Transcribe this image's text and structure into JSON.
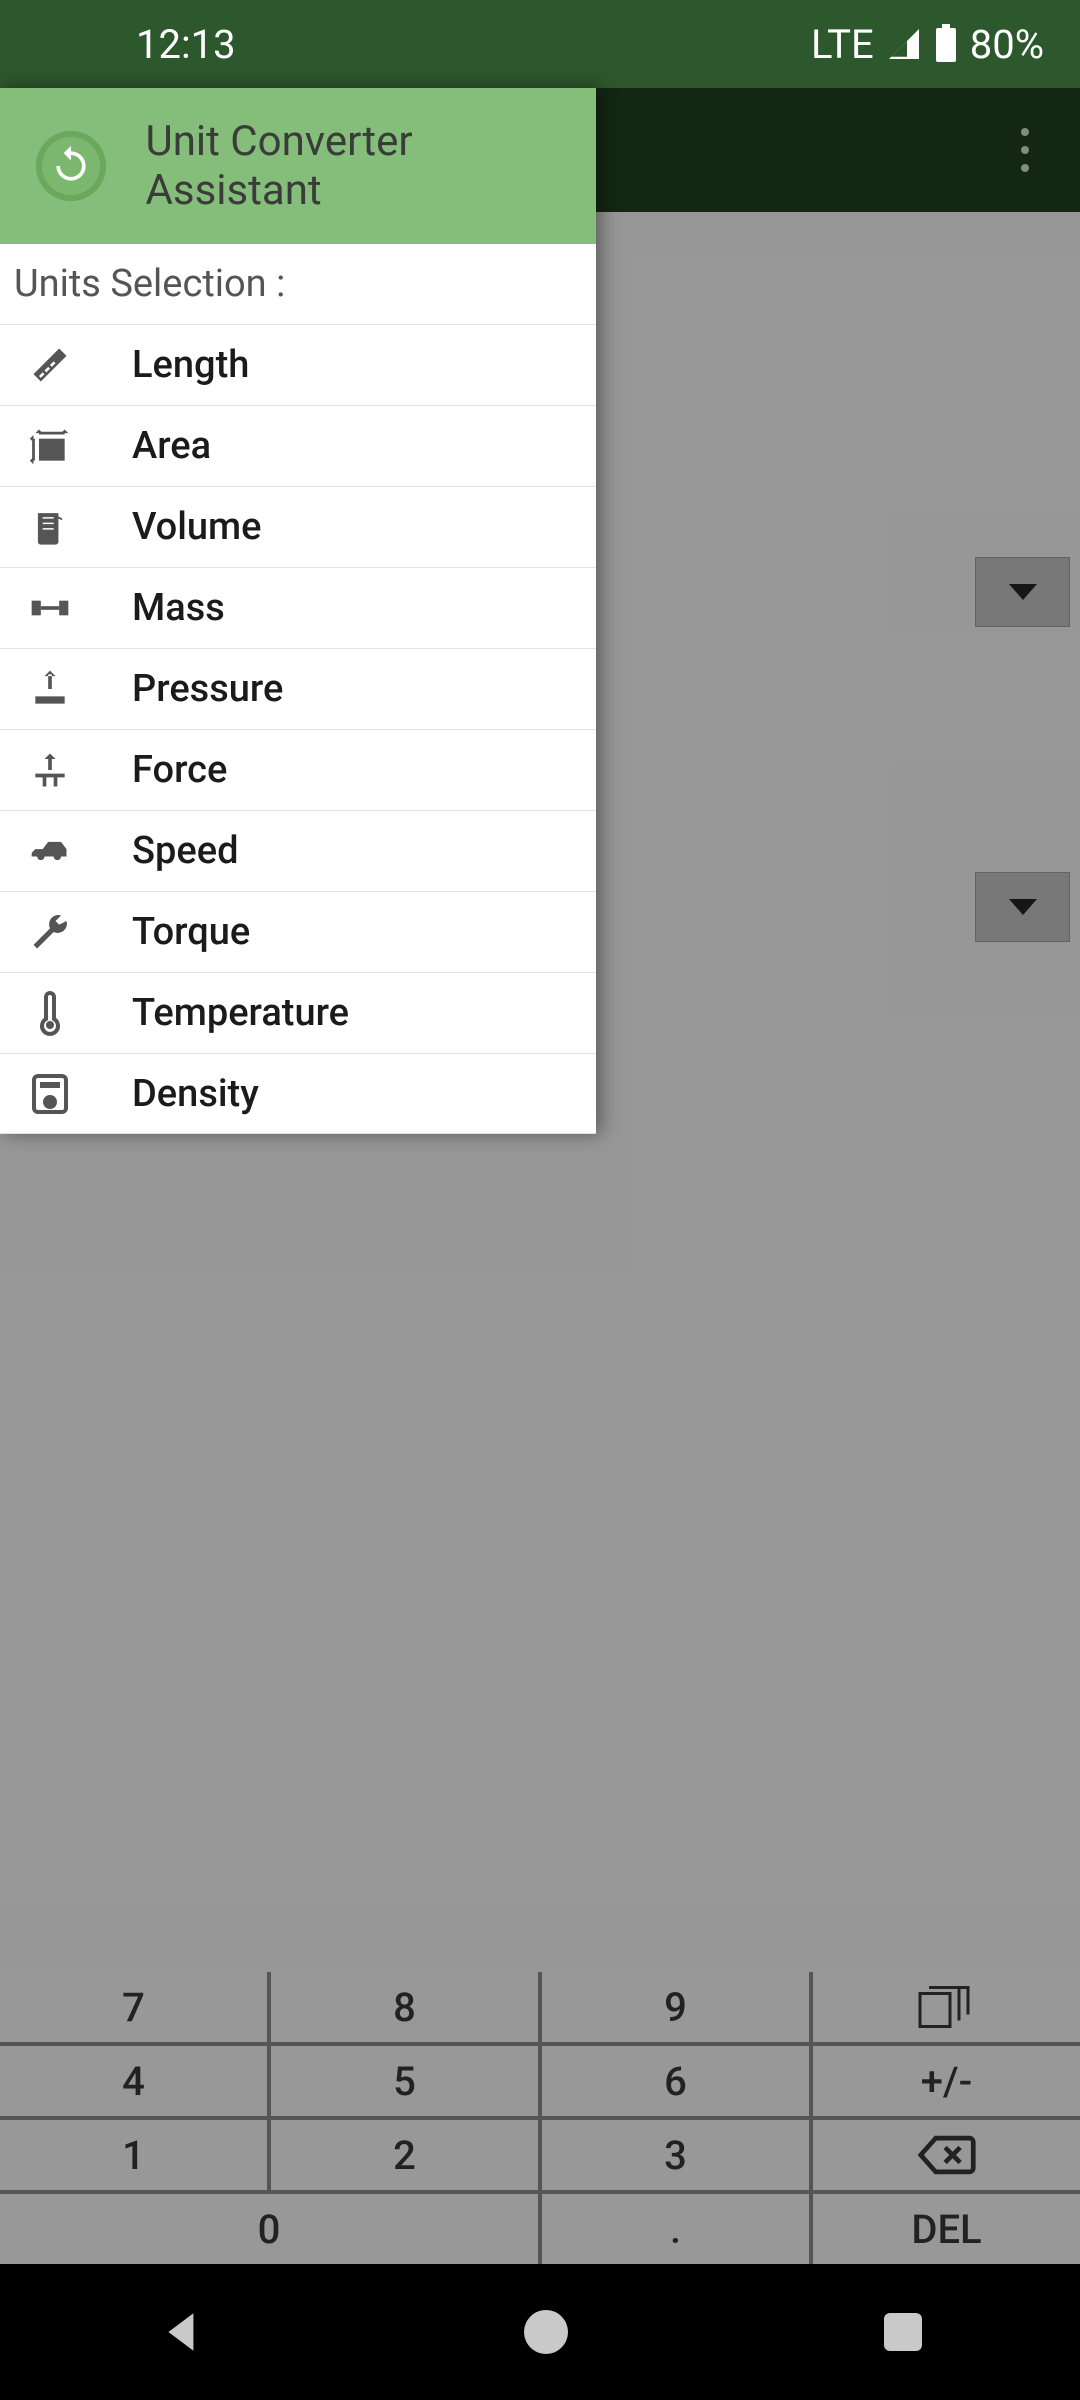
{
  "status": {
    "time": "12:13",
    "net": "LTE",
    "battery": "80%"
  },
  "app": {
    "title": "Unit Converter Assistant",
    "section": "Units Selection :"
  },
  "units": [
    {
      "label": "Length",
      "icon": "ruler-icon"
    },
    {
      "label": "Area",
      "icon": "area-icon"
    },
    {
      "label": "Volume",
      "icon": "beaker-icon"
    },
    {
      "label": "Mass",
      "icon": "dumbbell-icon"
    },
    {
      "label": "Pressure",
      "icon": "pressure-icon"
    },
    {
      "label": "Force",
      "icon": "force-icon"
    },
    {
      "label": "Speed",
      "icon": "car-icon"
    },
    {
      "label": "Torque",
      "icon": "wrench-icon"
    },
    {
      "label": "Temperature",
      "icon": "thermometer-icon"
    },
    {
      "label": "Density",
      "icon": "density-icon"
    }
  ],
  "keypad": {
    "rows": [
      [
        "7",
        "8",
        "9"
      ],
      [
        "4",
        "5",
        "6",
        "+/-"
      ],
      [
        "1",
        "2",
        "3"
      ],
      [
        "0",
        ".",
        "DEL"
      ]
    ],
    "clipboard_icon": "clipboard-icon",
    "backspace_icon": "backspace-icon"
  }
}
